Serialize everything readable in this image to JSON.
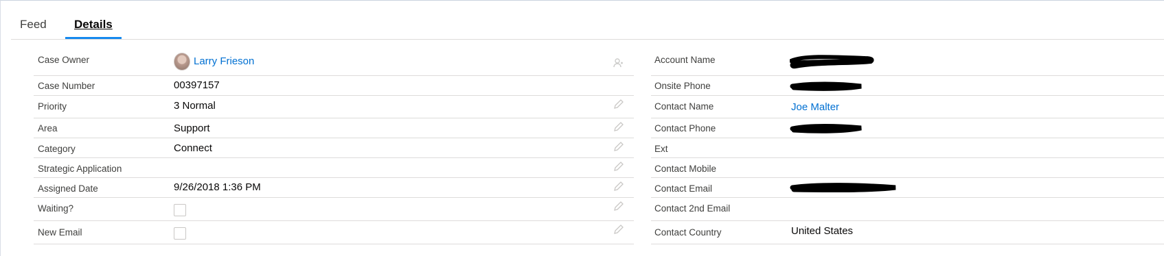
{
  "tabs": [
    {
      "label": "Feed",
      "active": false
    },
    {
      "label": "Details",
      "active": true
    }
  ],
  "left_fields": {
    "case_owner": {
      "label": "Case Owner",
      "value": "Larry Frieson"
    },
    "case_number": {
      "label": "Case Number",
      "value": "00397157"
    },
    "priority": {
      "label": "Priority",
      "value": "3 Normal"
    },
    "area": {
      "label": "Area",
      "value": "Support"
    },
    "category": {
      "label": "Category",
      "value": "Connect"
    },
    "strategic_application": {
      "label": "Strategic Application",
      "value": ""
    },
    "assigned_date": {
      "label": "Assigned Date",
      "value": "9/26/2018 1:36 PM"
    },
    "waiting": {
      "label": "Waiting?",
      "checked": false
    },
    "new_email": {
      "label": "New Email",
      "checked": false
    }
  },
  "right_fields": {
    "account_name": {
      "label": "Account Name",
      "redacted": true
    },
    "onsite_phone": {
      "label": "Onsite Phone",
      "redacted": true
    },
    "contact_name": {
      "label": "Contact Name",
      "value": "Joe Malter"
    },
    "contact_phone": {
      "label": "Contact Phone",
      "redacted": true
    },
    "ext": {
      "label": "Ext",
      "value": ""
    },
    "contact_mobile": {
      "label": "Contact Mobile",
      "value": ""
    },
    "contact_email": {
      "label": "Contact Email",
      "redacted": true
    },
    "contact_2nd_email": {
      "label": "Contact 2nd Email",
      "value": ""
    },
    "contact_country": {
      "label": "Contact Country",
      "value": "United States"
    }
  },
  "icons": {
    "edit": "pencil-icon",
    "change_owner": "change-owner-icon",
    "avatar": "user-avatar"
  },
  "colors": {
    "link": "#0070d2",
    "active_tab_underline": "#1589ee",
    "divider": "#dddbda",
    "label": "#3e3e3c",
    "value": "#080707"
  }
}
